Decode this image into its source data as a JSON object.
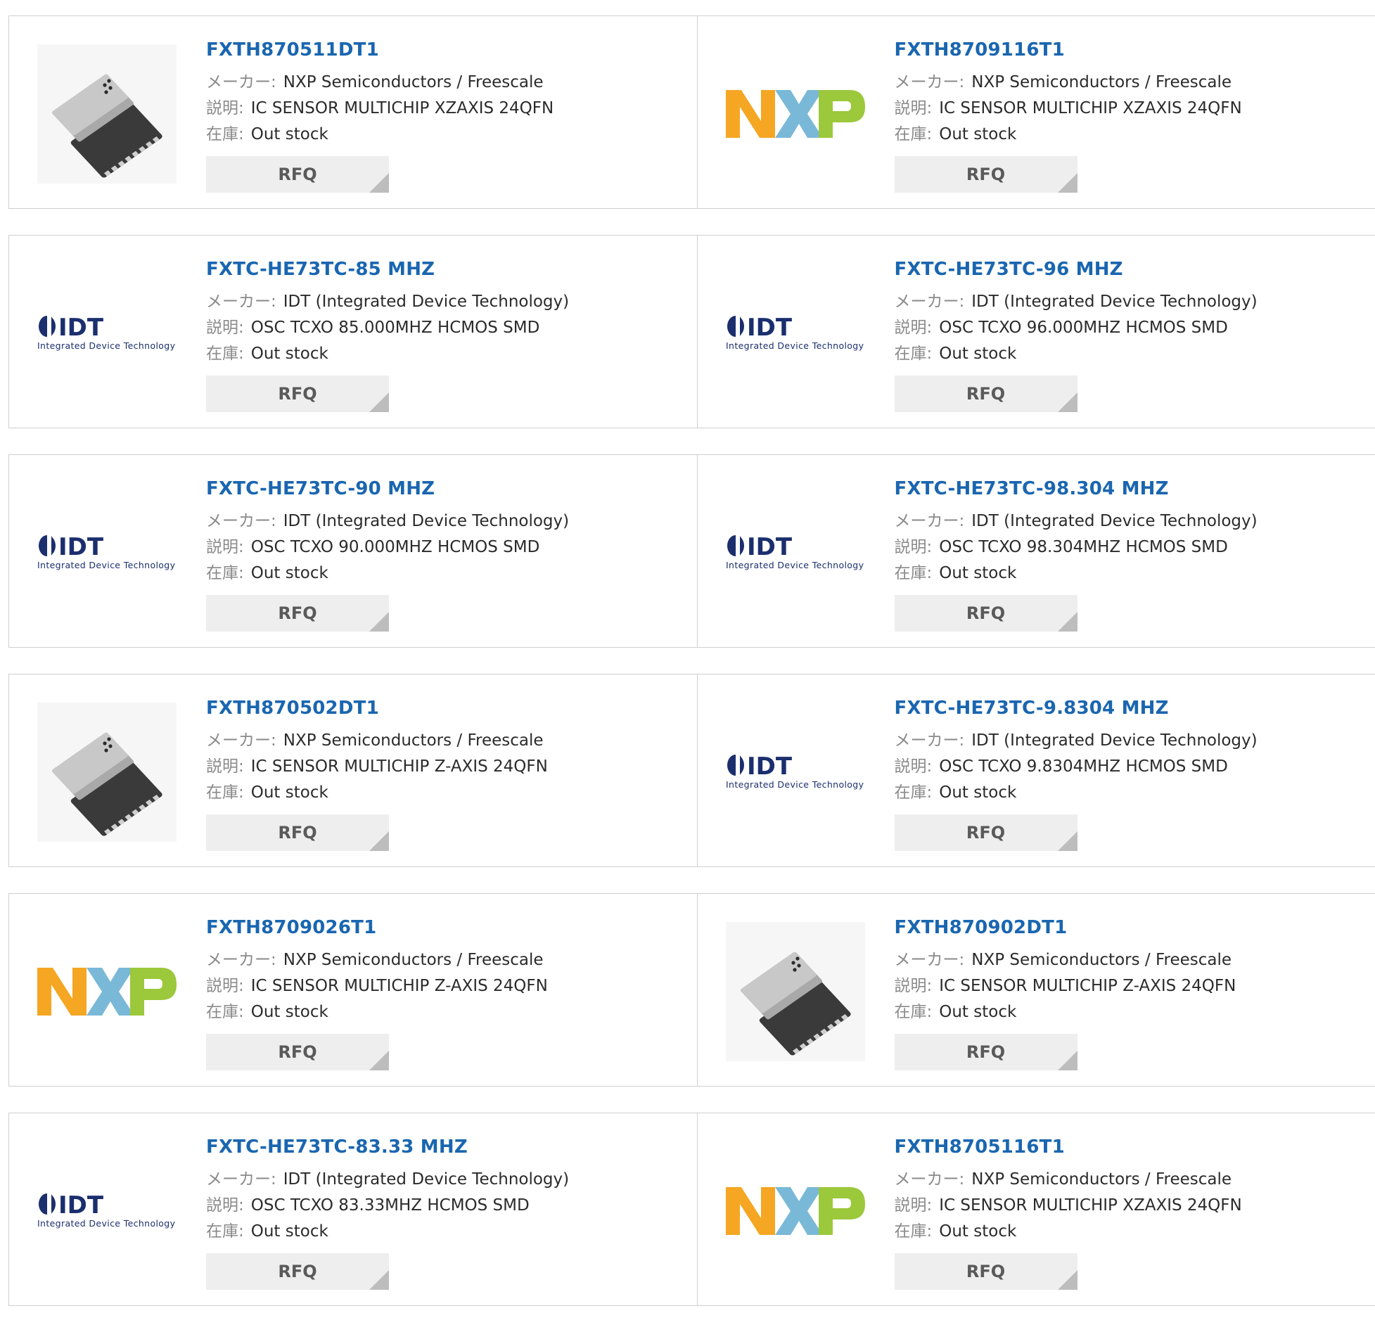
{
  "labels": {
    "maker": "メーカー:",
    "desc": "説明:",
    "stock": "在庫:",
    "rfq": "RFQ"
  },
  "logo_text": {
    "idt": "IDT",
    "idt_sub": "Integrated Device Technology",
    "nxp": "NXP"
  },
  "products": [
    {
      "pn": "FXTH870511DT1",
      "maker": "NXP Semiconductors / Freescale",
      "desc": "IC SENSOR MULTICHIP XZAXIS 24QFN",
      "stock": "Out stock",
      "logo": "chip"
    },
    {
      "pn": "FXTH8709116T1",
      "maker": "NXP Semiconductors / Freescale",
      "desc": "IC SENSOR MULTICHIP XZAXIS 24QFN",
      "stock": "Out stock",
      "logo": "nxp"
    },
    {
      "pn": "FXTC-HE73TC-85 MHZ",
      "maker": "IDT (Integrated Device Technology)",
      "desc": "OSC TCXO 85.000MHZ HCMOS SMD",
      "stock": "Out stock",
      "logo": "idt"
    },
    {
      "pn": "FXTC-HE73TC-96 MHZ",
      "maker": "IDT (Integrated Device Technology)",
      "desc": "OSC TCXO 96.000MHZ HCMOS SMD",
      "stock": "Out stock",
      "logo": "idt"
    },
    {
      "pn": "FXTC-HE73TC-90 MHZ",
      "maker": "IDT (Integrated Device Technology)",
      "desc": "OSC TCXO 90.000MHZ HCMOS SMD",
      "stock": "Out stock",
      "logo": "idt"
    },
    {
      "pn": "FXTC-HE73TC-98.304 MHZ",
      "maker": "IDT (Integrated Device Technology)",
      "desc": "OSC TCXO 98.304MHZ HCMOS SMD",
      "stock": "Out stock",
      "logo": "idt"
    },
    {
      "pn": "FXTH870502DT1",
      "maker": "NXP Semiconductors / Freescale",
      "desc": "IC SENSOR MULTICHIP Z-AXIS 24QFN",
      "stock": "Out stock",
      "logo": "chip"
    },
    {
      "pn": "FXTC-HE73TC-9.8304 MHZ",
      "maker": "IDT (Integrated Device Technology)",
      "desc": "OSC TCXO 9.8304MHZ HCMOS SMD",
      "stock": "Out stock",
      "logo": "idt"
    },
    {
      "pn": "FXTH8709026T1",
      "maker": "NXP Semiconductors / Freescale",
      "desc": "IC SENSOR MULTICHIP Z-AXIS 24QFN",
      "stock": "Out stock",
      "logo": "nxp"
    },
    {
      "pn": "FXTH870902DT1",
      "maker": "NXP Semiconductors / Freescale",
      "desc": "IC SENSOR MULTICHIP Z-AXIS 24QFN",
      "stock": "Out stock",
      "logo": "chip"
    },
    {
      "pn": "FXTC-HE73TC-83.33 MHZ",
      "maker": "IDT (Integrated Device Technology)",
      "desc": "OSC TCXO 83.33MHZ HCMOS SMD",
      "stock": "Out stock",
      "logo": "idt"
    },
    {
      "pn": "FXTH8705116T1",
      "maker": "NXP Semiconductors / Freescale",
      "desc": "IC SENSOR MULTICHIP XZAXIS 24QFN",
      "stock": "Out stock",
      "logo": "nxp"
    }
  ],
  "colors": {
    "link": "#1a66b0",
    "nxp_orange": "#f5a623",
    "nxp_blue": "#7ab8d8",
    "nxp_green": "#9cc83c",
    "idt_navy": "#1b2f6e"
  }
}
